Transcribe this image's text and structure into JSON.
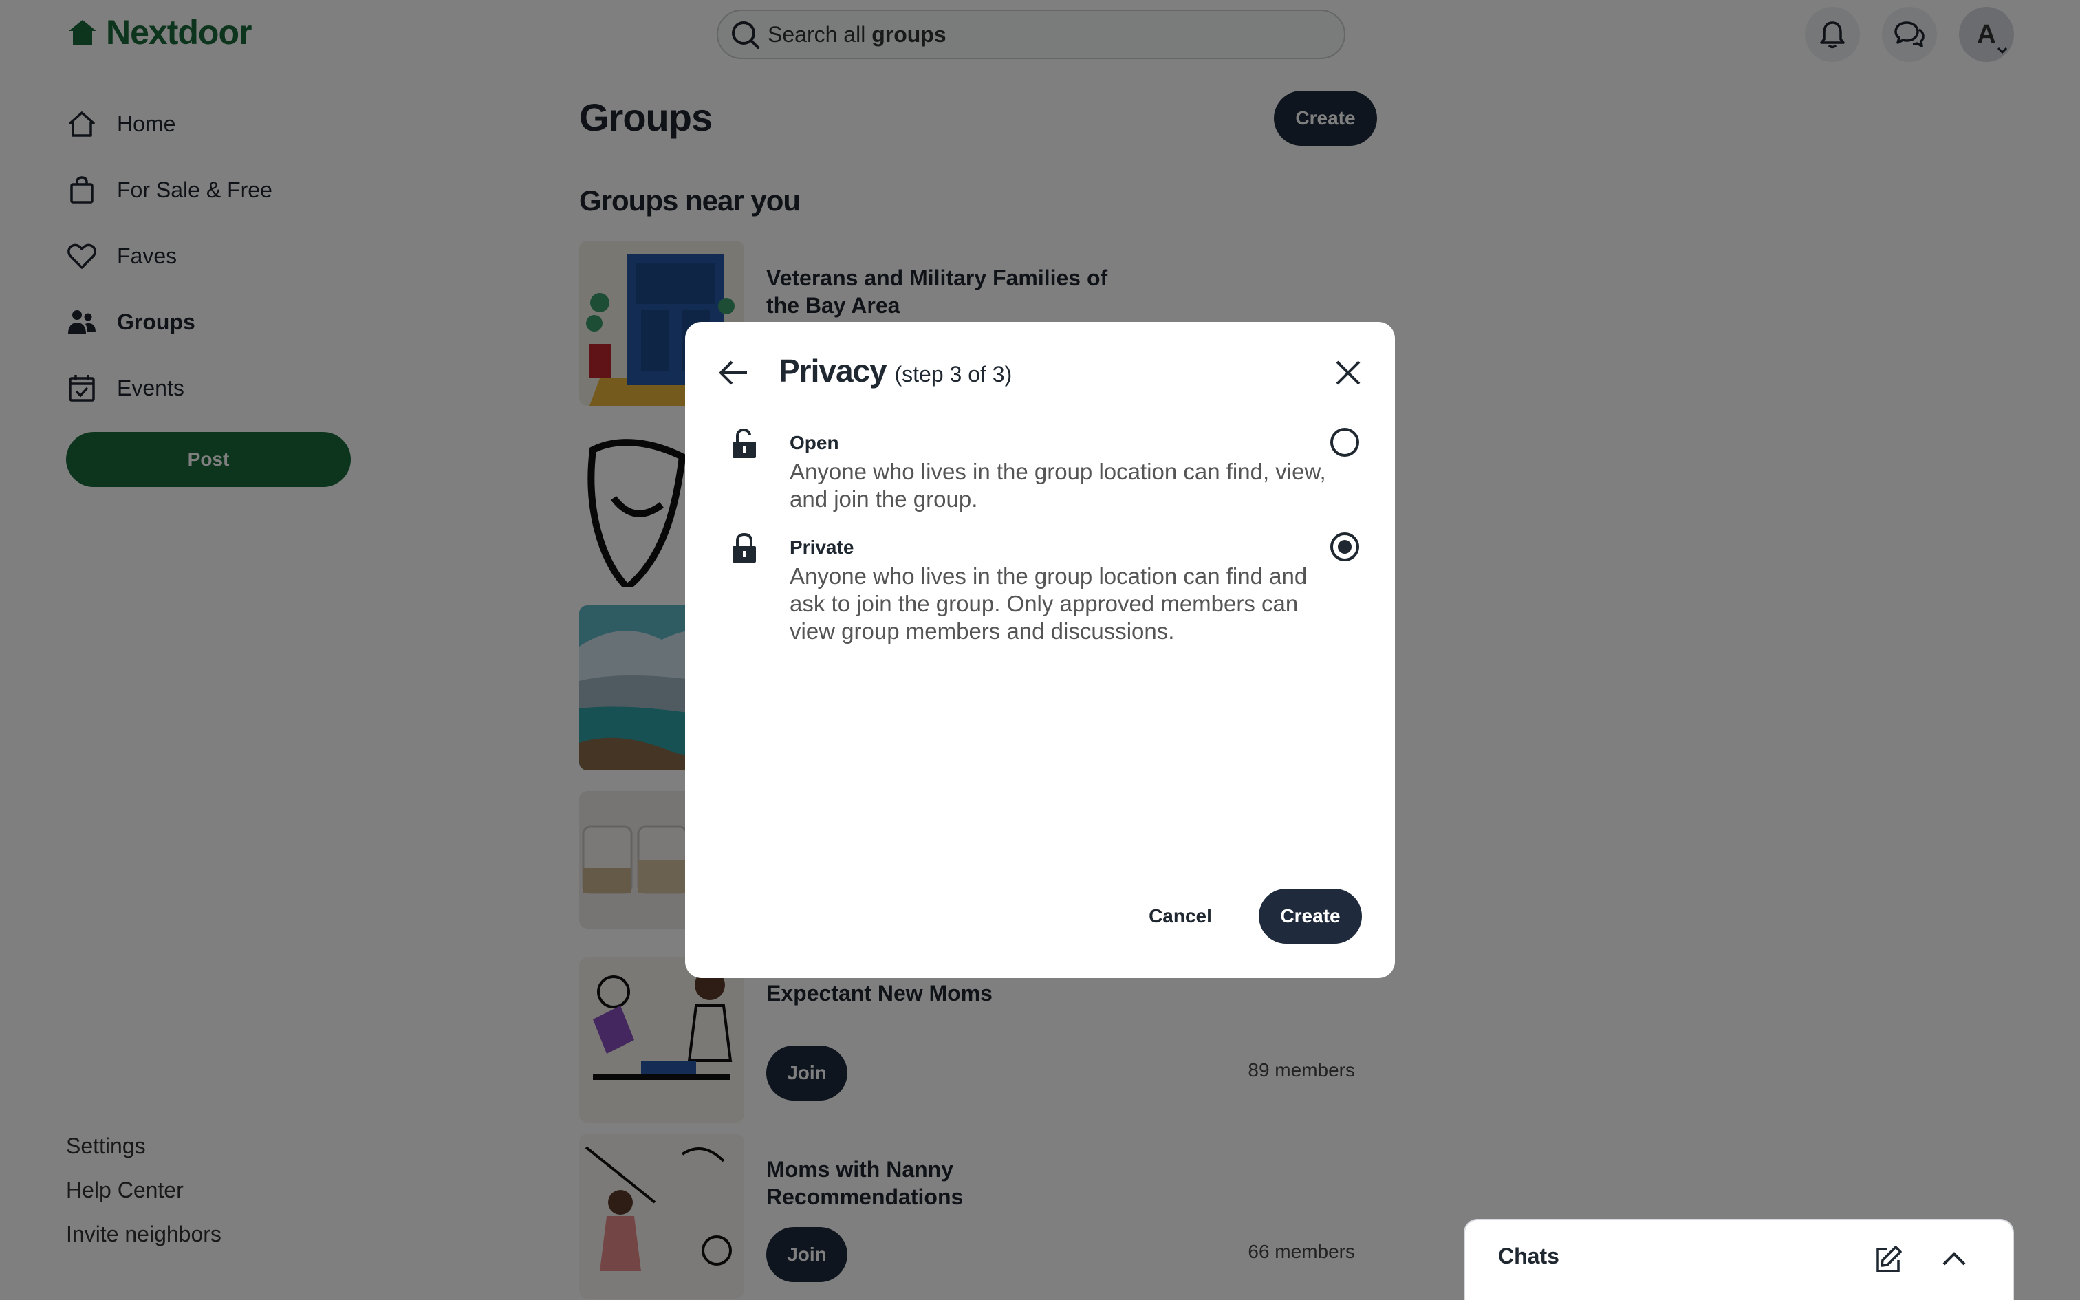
{
  "header": {
    "logo_text": "Nextdoor",
    "search_prefix": "Search all",
    "search_bold": "groups",
    "brand_color": "#1b6b3a"
  },
  "sidebar": {
    "items": [
      {
        "label": "Home",
        "icon": "home-icon"
      },
      {
        "label": "For Sale & Free",
        "icon": "shopping-bag-icon"
      },
      {
        "label": "Faves",
        "icon": "heart-icon"
      },
      {
        "label": "Groups",
        "icon": "people-icon",
        "active": true
      },
      {
        "label": "Events",
        "icon": "calendar-check-icon"
      }
    ],
    "post_label": "Post",
    "footer_links": [
      "Settings",
      "Help Center",
      "Invite neighbors"
    ]
  },
  "user": {
    "avatar_initial": "A"
  },
  "main": {
    "title": "Groups",
    "create_label": "Create",
    "section_title": "Groups near you",
    "groups": [
      {
        "name": "Veterans and Military Families of the Bay Area"
      },
      {
        "name": "Expectant New Moms",
        "join_label": "Join",
        "members": "89 members"
      },
      {
        "name": "Moms with Nanny Recommendations",
        "join_label": "Join",
        "members": "66 members"
      }
    ]
  },
  "modal": {
    "title": "Privacy",
    "step": "(step 3 of 3)",
    "options": [
      {
        "label": "Open",
        "description": "Anyone who lives in the group location can find, view, and join the group.",
        "selected": false
      },
      {
        "label": "Private",
        "description": "Anyone who lives in the group location can find and ask to join the group. Only approved members can view group members and discussions.",
        "selected": true
      }
    ],
    "cancel_label": "Cancel",
    "create_label": "Create"
  },
  "chats": {
    "label": "Chats"
  }
}
